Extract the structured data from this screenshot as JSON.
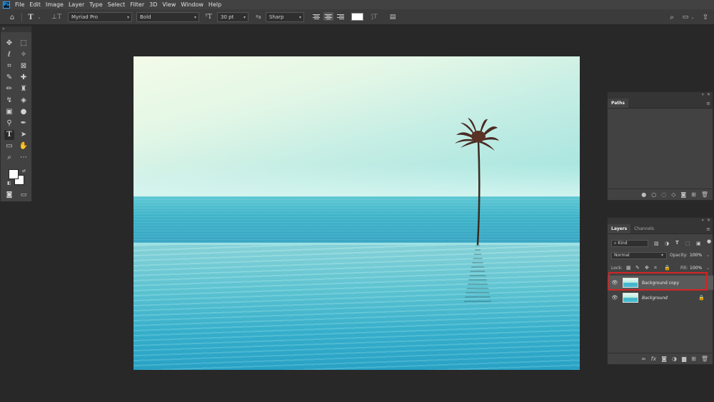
{
  "menu": [
    "File",
    "Edit",
    "Image",
    "Layer",
    "Type",
    "Select",
    "Filter",
    "3D",
    "View",
    "Window",
    "Help"
  ],
  "app_logo": "Ps",
  "options": {
    "font_family": "Myriad Pro",
    "font_style": "Bold",
    "font_size": "30 pt",
    "antialias": "Sharp"
  },
  "paths_panel": {
    "tab": "Paths"
  },
  "layers_panel": {
    "tabs": [
      "Layers",
      "Channels"
    ],
    "filter_kind": "Kind",
    "blend_mode": "Normal",
    "opacity_label": "Opacity:",
    "opacity_value": "100%",
    "lock_label": "Lock:",
    "fill_label": "Fill:",
    "fill_value": "100%",
    "layers": [
      {
        "name": "Background copy",
        "visible": true,
        "selected": true
      },
      {
        "name": "Background",
        "visible": true,
        "locked": true
      }
    ]
  },
  "colors": {
    "highlight": "#d42323",
    "panel_bg": "#424242",
    "workspace_bg": "#282828"
  }
}
